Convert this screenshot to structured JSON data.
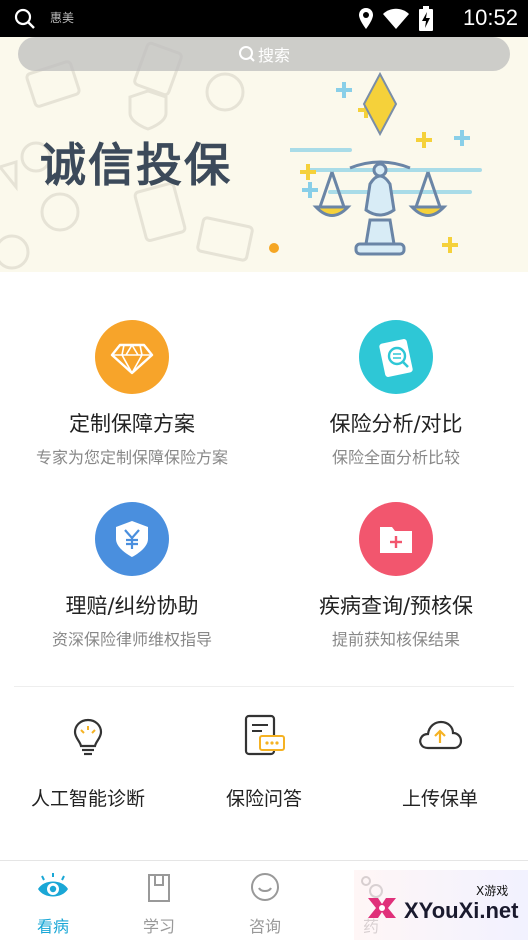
{
  "status_bar": {
    "app_label": "惠美",
    "time": "10:52"
  },
  "search": {
    "placeholder": "搜索"
  },
  "banner": {
    "title": "诚信投保"
  },
  "features": [
    {
      "title": "定制保障方案",
      "subtitle": "专家为您定制保障保险方案",
      "icon": "diamond-icon",
      "color": "#f7a42a"
    },
    {
      "title": "保险分析/对比",
      "subtitle": "保险全面分析比较",
      "icon": "document-search-icon",
      "color": "#2ec7d6"
    },
    {
      "title": "理赔/纠纷协助",
      "subtitle": "资深保险律师维权指导",
      "icon": "shield-yuan-icon",
      "color": "#4a8fde"
    },
    {
      "title": "疾病查询/预核保",
      "subtitle": "提前获知核保结果",
      "icon": "folder-plus-icon",
      "color": "#f2566e"
    }
  ],
  "tools": [
    {
      "label": "人工智能诊断",
      "icon": "lightbulb-icon"
    },
    {
      "label": "保险问答",
      "icon": "chat-document-icon"
    },
    {
      "label": "上传保单",
      "icon": "cloud-upload-icon"
    }
  ],
  "tabs": [
    {
      "label": "看病",
      "icon": "eye-icon",
      "active": true
    },
    {
      "label": "学习",
      "icon": "book-icon",
      "active": false
    },
    {
      "label": "咨询",
      "icon": "chat-bubble-icon",
      "active": false
    },
    {
      "label": "药",
      "icon": "pill-icon",
      "active": false
    }
  ],
  "watermark": {
    "brand": "XYouXi.net",
    "tag": "X游戏"
  },
  "colors": {
    "accent": "#1aa7d6",
    "banner_bg": "#fbf9ec",
    "banner_title": "#3c4a5a",
    "indicator": "#f5a623"
  }
}
